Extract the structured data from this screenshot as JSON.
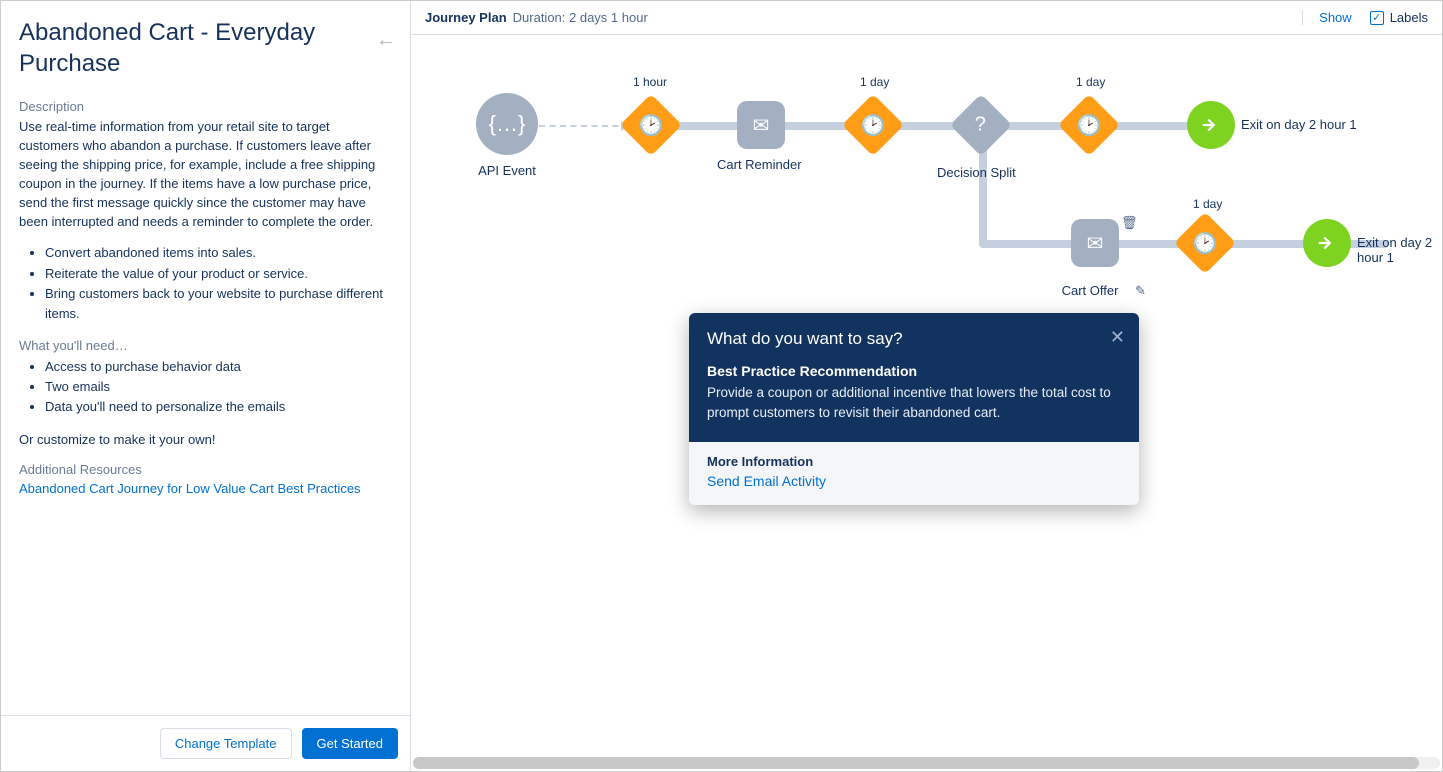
{
  "sidebar": {
    "title": "Abandoned Cart - Everyday Purchase",
    "description_label": "Description",
    "description_text": "Use real-time information from your retail site to target customers who abandon a purchase. If customers leave after seeing the shipping price, for example, include a free shipping coupon in the journey. If the items have a low purchase price, send the first message quickly since the customer may have been interrupted and needs a reminder to complete the order.",
    "bullets_main": [
      "Convert abandoned items into sales.",
      "Reiterate the value of your product or service.",
      "Bring customers back to your website to purchase different items."
    ],
    "what_need_label": "What you'll need…",
    "bullets_need": [
      "Access to purchase behavior data",
      "Two emails",
      "Data you'll need to personalize the emails"
    ],
    "customize_text": "Or customize to make it your own!",
    "resources_label": "Additional Resources",
    "resources_link": "Abandoned Cart Journey for Low Value Cart Best Practices",
    "change_template": "Change Template",
    "get_started": "Get Started"
  },
  "header": {
    "title": "Journey Plan",
    "duration": "Duration: 2 days 1 hour",
    "show": "Show",
    "labels": "Labels"
  },
  "nodes": {
    "api_event": "API Event",
    "wait_1h": "1 hour",
    "cart_reminder": "Cart Reminder",
    "wait_1d_a": "1 day",
    "decision_split": "Decision Split",
    "wait_1d_b": "1 day",
    "exit_1": "Exit on day 2 hour 1",
    "wait_1d_c": "1 day",
    "cart_offer": "Cart Offer",
    "exit_2": "Exit on day 2 hour 1"
  },
  "popover": {
    "title": "What do you want to say?",
    "subtitle": "Best Practice Recommendation",
    "recommendation": "Provide a coupon or additional incentive that lowers the total cost to prompt customers to revisit their abandoned cart.",
    "more_info": "More Information",
    "link": "Send Email Activity"
  }
}
